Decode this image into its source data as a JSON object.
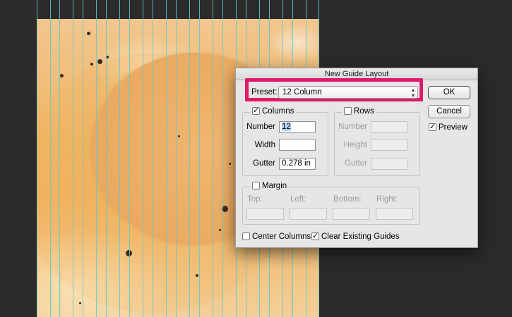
{
  "dialog": {
    "title": "New Guide Layout",
    "preset_label": "Preset:",
    "preset_value": "12 Column",
    "ok_label": "OK",
    "cancel_label": "Cancel",
    "preview_label": "Preview",
    "preview_checked": true,
    "columns": {
      "label": "Columns",
      "checked": true,
      "number_label": "Number",
      "number_value": "12",
      "width_label": "Width",
      "width_value": "",
      "gutter_label": "Gutter",
      "gutter_value": "0.278 in"
    },
    "rows": {
      "label": "Rows",
      "checked": false,
      "number_label": "Number",
      "height_label": "Height",
      "gutter_label": "Gutter"
    },
    "margin": {
      "label": "Margin",
      "checked": false,
      "top_label": "Top:",
      "left_label": "Left:",
      "bottom_label": "Bottom:",
      "right_label": "Right:"
    },
    "center_columns_label": "Center Columns",
    "center_columns_checked": false,
    "clear_guides_label": "Clear Existing Guides",
    "clear_guides_checked": true
  },
  "colors": {
    "highlight": "#e0186a",
    "guide": "#63c9cc",
    "background": "#2b2b2b"
  }
}
